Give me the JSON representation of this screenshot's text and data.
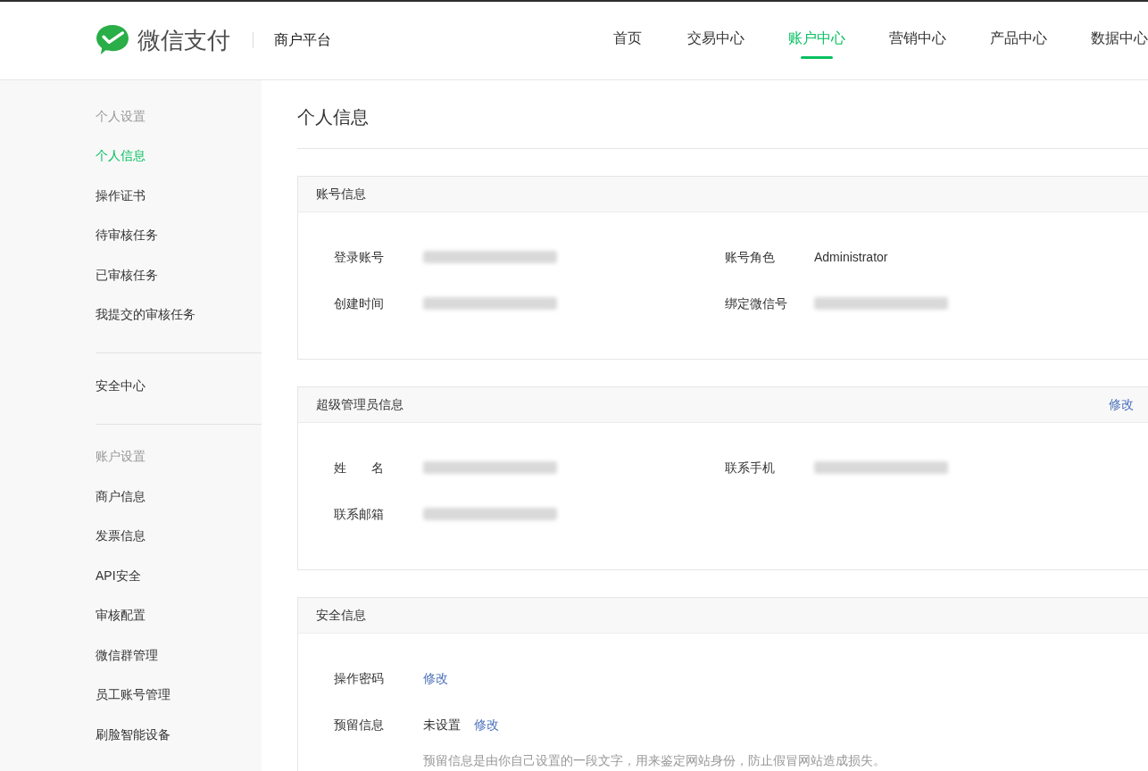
{
  "header": {
    "logo_text": "微信支付",
    "platform": "商户平台",
    "nav": [
      {
        "label": "首页",
        "selected": false
      },
      {
        "label": "交易中心",
        "selected": false
      },
      {
        "label": "账户中心",
        "selected": true
      },
      {
        "label": "营销中心",
        "selected": false
      },
      {
        "label": "产品中心",
        "selected": false
      },
      {
        "label": "数据中心",
        "selected": false
      }
    ]
  },
  "sidebar": {
    "groups": [
      {
        "heading": "个人设置",
        "items": [
          {
            "label": "个人信息",
            "selected": true
          },
          {
            "label": "操作证书",
            "selected": false
          },
          {
            "label": "待审核任务",
            "selected": false
          },
          {
            "label": "已审核任务",
            "selected": false
          },
          {
            "label": "我提交的审核任务",
            "selected": false
          }
        ]
      },
      {
        "items": [
          {
            "label": "安全中心",
            "selected": false
          }
        ]
      },
      {
        "heading": "账户设置",
        "items": [
          {
            "label": "商户信息",
            "selected": false
          },
          {
            "label": "发票信息",
            "selected": false
          },
          {
            "label": "API安全",
            "selected": false
          },
          {
            "label": "审核配置",
            "selected": false
          },
          {
            "label": "微信群管理",
            "selected": false
          },
          {
            "label": "员工账号管理",
            "selected": false
          },
          {
            "label": "刷脸智能设备",
            "selected": false
          }
        ]
      }
    ]
  },
  "page": {
    "title": "个人信息",
    "sections": [
      {
        "title": "账号信息",
        "kind": "grid",
        "fields": [
          {
            "label": "登录账号",
            "kind": "redacted"
          },
          {
            "label": "账号角色",
            "kind": "text",
            "value": "Administrator"
          },
          {
            "label": "创建时间",
            "kind": "redacted"
          },
          {
            "label": "绑定微信号",
            "kind": "redacted"
          }
        ]
      },
      {
        "title": "超级管理员信息",
        "action": "修改",
        "kind": "grid",
        "fields": [
          {
            "label": "姓 名",
            "kind": "redacted"
          },
          {
            "label": "联系手机",
            "kind": "redacted"
          },
          {
            "label": "联系邮箱",
            "kind": "redacted"
          }
        ]
      },
      {
        "title": "安全信息",
        "kind": "list",
        "fields": [
          {
            "label": "操作密码",
            "kind": "parts",
            "parts": [
              {
                "kind": "link",
                "text": "修改"
              }
            ]
          },
          {
            "label": "预留信息",
            "kind": "parts",
            "parts": [
              {
                "kind": "text",
                "text": "未设置"
              },
              {
                "kind": "link",
                "text": "修改"
              }
            ],
            "note": "预留信息是由你自己设置的一段文字，用来鉴定网站身份，防止假冒网站造成损失。"
          }
        ]
      }
    ]
  }
}
